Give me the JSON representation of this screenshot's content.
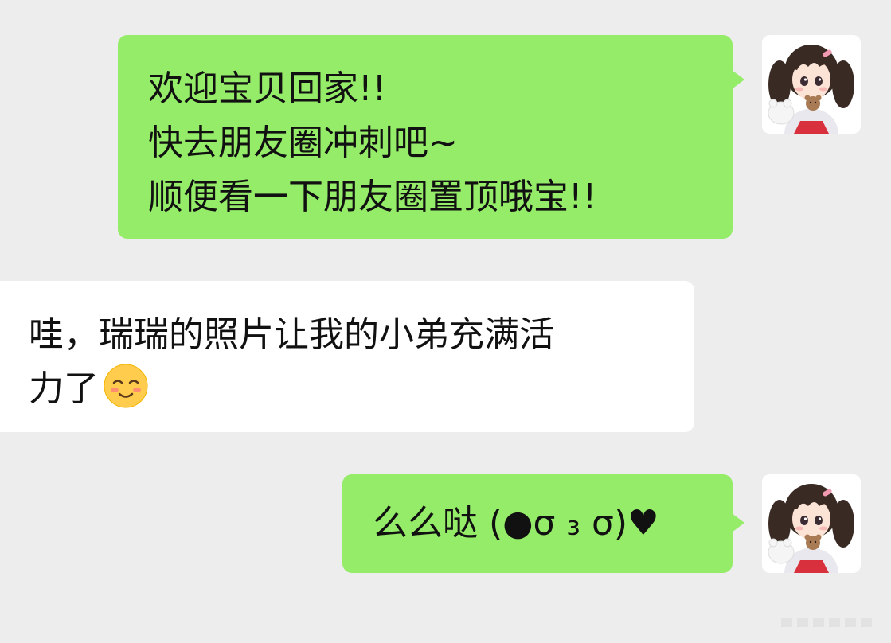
{
  "chat": {
    "messages": [
      {
        "side": "sent",
        "lines": [
          "欢迎宝贝回家!!",
          "快去朋友圈冲刺吧~",
          "顺便看一下朋友圈置顶哦宝!!"
        ]
      },
      {
        "side": "received",
        "lines": [
          "哇，瑞瑞的照片让我的小弟充满活",
          "力了"
        ],
        "emoji": "smiling-blush-emoji"
      },
      {
        "side": "sent",
        "lines": [
          "么么哒 (●σ ₃ σ)♥"
        ]
      }
    ],
    "avatar": {
      "icon": "anime-girl-avatar-icon"
    }
  },
  "colors": {
    "background": "#ededed",
    "sent_bubble": "#95ec69",
    "received_bubble": "#ffffff",
    "text": "#111111"
  }
}
